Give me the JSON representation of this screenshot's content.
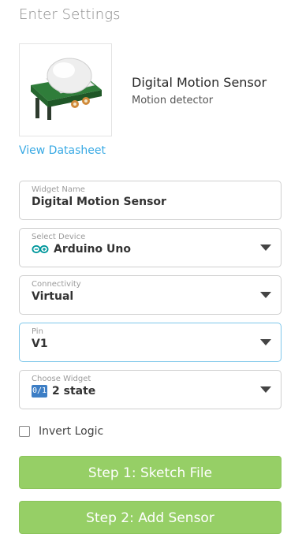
{
  "title": "Enter Settings",
  "sensor": {
    "name": "Digital Motion Sensor",
    "description": "Motion detector",
    "datasheet_link": "View Datasheet"
  },
  "fields": {
    "widget_name": {
      "label": "Widget Name",
      "value": "Digital Motion Sensor"
    },
    "device": {
      "label": "Select Device",
      "value": "Arduino Uno",
      "icon": "arduino-icon"
    },
    "connectivity": {
      "label": "Connectivity",
      "value": "Virtual"
    },
    "pin": {
      "label": "Pin",
      "value": "V1"
    },
    "widget": {
      "label": "Choose Widget",
      "value": "2 state",
      "badge": "0/1",
      "icon": "toggle-widget-icon"
    }
  },
  "invert_logic": {
    "label": "Invert Logic",
    "checked": false
  },
  "buttons": {
    "step1": "Step 1: Sketch File",
    "step2": "Step 2: Add Sensor"
  },
  "colors": {
    "accent_link": "#38a9e4",
    "button_green": "#96cf66",
    "focus_border": "#7ec7ea",
    "badge_blue": "#3d7ec5",
    "arduino_teal": "#00979c"
  }
}
